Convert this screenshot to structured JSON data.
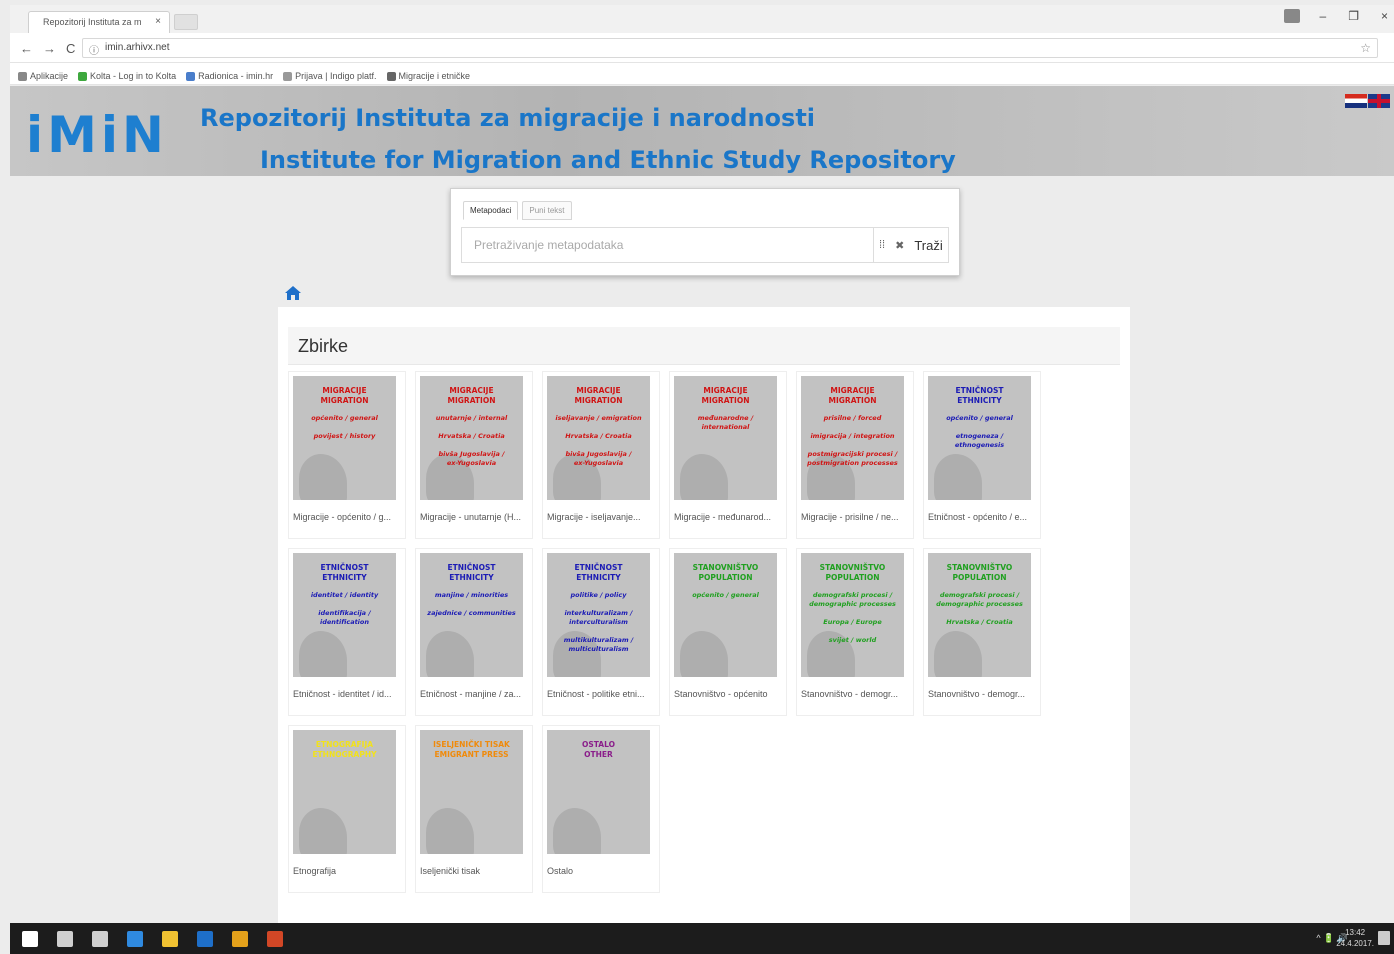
{
  "browser": {
    "tab_title": "Repozitorij Instituta za m",
    "tab_close": "×",
    "window_buttons": [
      "–",
      "❐",
      "×"
    ],
    "url_info": "ⓘ",
    "url": "imin.arhivx.net",
    "nav": [
      "←",
      "→",
      "C"
    ],
    "star": "☆",
    "bookmarks": [
      {
        "label": "Aplikacije",
        "color": "#888888"
      },
      {
        "label": "Kolta - Log in to Kolta",
        "color": "#3ea83e"
      },
      {
        "label": "Radionica - imin.hr",
        "color": "#4a7ecb"
      },
      {
        "label": "Prijava | Indigo platf.",
        "color": "#999999"
      },
      {
        "label": "Migracije i etničke",
        "color": "#666666"
      }
    ]
  },
  "header": {
    "logo": "iMiN",
    "title_hr": "Repozitorij Instituta za migracije i narodnosti",
    "title_en": "Institute for Migration and Ethnic Study Repository"
  },
  "search": {
    "tabs": [
      "Metapodaci",
      "Puni tekst"
    ],
    "placeholder": "Pretraživanje metapodataka",
    "clear": "✖",
    "submit": "Traži",
    "options": "⁞⁞"
  },
  "collections": {
    "title": "Zbirke",
    "items": [
      {
        "color": "red",
        "title": "MIGRACIJE\nMIGRATION",
        "sub": "općenito / general\n\npovijest / history",
        "caption": "Migracije - općenito / g..."
      },
      {
        "color": "red",
        "title": "MIGRACIJE\nMIGRATION",
        "sub": "unutarnje / internal\n\nHrvatska / Croatia\n\nbivša Jugoslavija /\nex-Yugoslavia",
        "caption": "Migracije - unutarnje (H..."
      },
      {
        "color": "red",
        "title": "MIGRACIJE\nMIGRATION",
        "sub": "iseljavanje / emigration\n\nHrvatska / Croatia\n\nbivša Jugoslavija /\nex-Yugoslavia",
        "caption": "Migracije - iseljavanje..."
      },
      {
        "color": "red",
        "title": "MIGRACIJE\nMIGRATION",
        "sub": "međunarodne /\ninternational",
        "caption": "Migracije - međunarod..."
      },
      {
        "color": "red",
        "title": "MIGRACIJE\nMIGRATION",
        "sub": "prisilne / forced\n\nimigracija / integration\n\npostmigracijski procesi /\npostmigration processes",
        "caption": "Migracije - prisilne / ne..."
      },
      {
        "color": "blue",
        "title": "ETNIČNOST\nETHNICITY",
        "sub": "općenito / general\n\netnogeneza /\nethnogenesis",
        "caption": "Etničnost - općenito / e..."
      },
      {
        "color": "blue",
        "title": "ETNIČNOST\nETHNICITY",
        "sub": "identitet / identity\n\nidentifikacija /\nidentification",
        "caption": "Etničnost - identitet / id..."
      },
      {
        "color": "blue",
        "title": "ETNIČNOST\nETHNICITY",
        "sub": "manjine / minorities\n\nzajednice / communities",
        "caption": "Etničnost - manjine / za..."
      },
      {
        "color": "blue",
        "title": "ETNIČNOST\nETHNICITY",
        "sub": "politike / policy\n\ninterkulturalizam /\ninterculturalism\n\nmultikulturalizam /\nmulticulturalism",
        "caption": "Etničnost - politike etni..."
      },
      {
        "color": "green",
        "title": "STANOVNIŠTVO\nPOPULATION",
        "sub": "općenito / general",
        "caption": "Stanovništvo - općenito"
      },
      {
        "color": "green",
        "title": "STANOVNIŠTVO\nPOPULATION",
        "sub": "demografski procesi /\ndemographic processes\n\nEuropa / Europe\n\nsvijet / world",
        "caption": "Stanovništvo - demogr..."
      },
      {
        "color": "green",
        "title": "STANOVNIŠTVO\nPOPULATION",
        "sub": "demografski procesi /\ndemographic processes\n\nHrvatska / Croatia",
        "caption": "Stanovništvo - demogr..."
      },
      {
        "color": "yellow",
        "title": "ETNOGRAFIJA\nETHNOGRAPHY",
        "sub": "",
        "caption": "Etnografija"
      },
      {
        "color": "orange",
        "title": "ISELJENIČKI TISAK\nEMIGRANT PRESS",
        "sub": "",
        "caption": "Iseljenički tisak"
      },
      {
        "color": "purple",
        "title": "OSTALO\nOTHER",
        "sub": "",
        "caption": "Ostalo"
      }
    ]
  },
  "taskbar": {
    "tray": "^ 🔋 🔊",
    "time": "13:42",
    "date": "24.4.2017.",
    "apps": [
      {
        "name": "windows",
        "color": "#ffffff"
      },
      {
        "name": "search",
        "color": "#cfcfcf"
      },
      {
        "name": "task-view",
        "color": "#cfcfcf"
      },
      {
        "name": "edge",
        "color": "#2f8ae0"
      },
      {
        "name": "explorer",
        "color": "#f1c232"
      },
      {
        "name": "outlook",
        "color": "#1e6fc9"
      },
      {
        "name": "chrome",
        "color": "#e4a11b"
      },
      {
        "name": "powerpoint",
        "color": "#d24726"
      }
    ]
  }
}
